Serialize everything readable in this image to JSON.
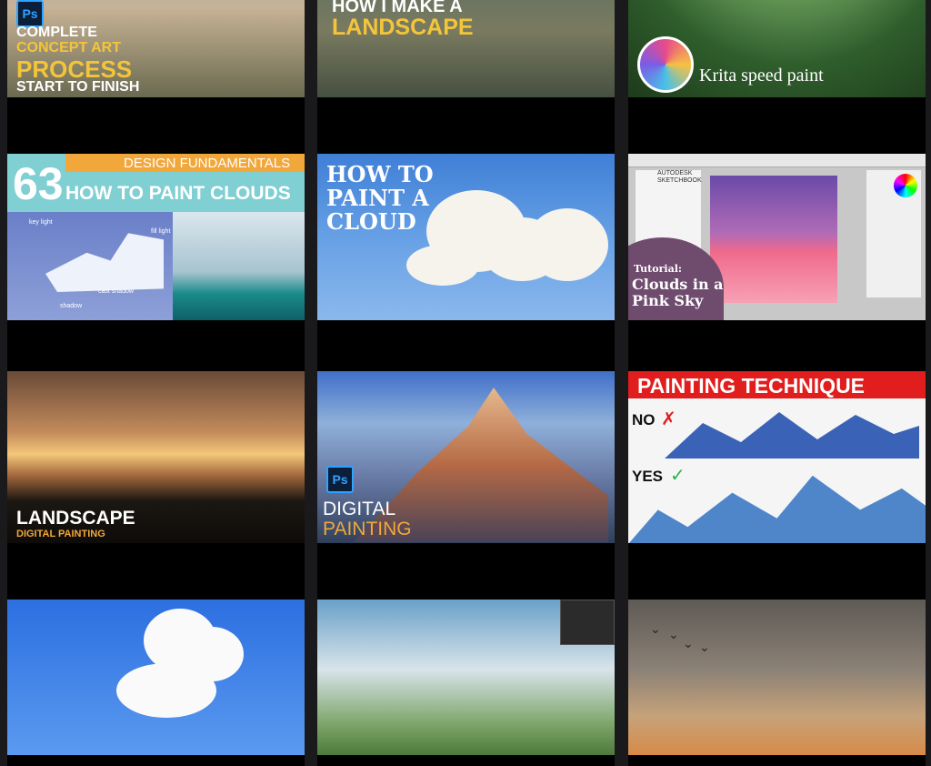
{
  "thumbnails": [
    {
      "ps": "Ps",
      "lines": [
        "COMPLETE",
        "CONCEPT ART",
        "PROCESS",
        "START TO FINISH"
      ]
    },
    {
      "lines": [
        "HOW I MAKE A",
        "LANDSCAPE"
      ]
    },
    {
      "lines": [
        "Krita speed paint"
      ]
    },
    {
      "lines": [
        "63",
        "DESIGN FUNDAMENTALS",
        "HOW TO PAINT CLOUDS",
        "key light",
        "fill light",
        "cast shadow",
        "shadow"
      ]
    },
    {
      "lines": [
        "HOW TO",
        "PAINT A",
        "CLOUD"
      ]
    },
    {
      "lines": [
        "AUTODESK",
        "SKETCHBOOK",
        "Tutorial:",
        "Clouds in a",
        "Pink Sky"
      ]
    },
    {
      "lines": [
        "LANDSCAPE",
        "DIGITAL PAINTING"
      ]
    },
    {
      "ps": "Ps",
      "lines": [
        "DIGITAL",
        "PAINTING"
      ]
    },
    {
      "lines": [
        "PAINTING TECHNIQUE",
        "NO",
        "YES"
      ]
    },
    {
      "lines": []
    },
    {
      "lines": []
    },
    {
      "lines": []
    }
  ],
  "colors": {
    "background": "#1a1a1c",
    "accent_orange": "#f2a73b",
    "accent_yellow": "#f3c53a",
    "accent_red": "#e11d1d",
    "ps_blue": "#2fa3ff"
  }
}
